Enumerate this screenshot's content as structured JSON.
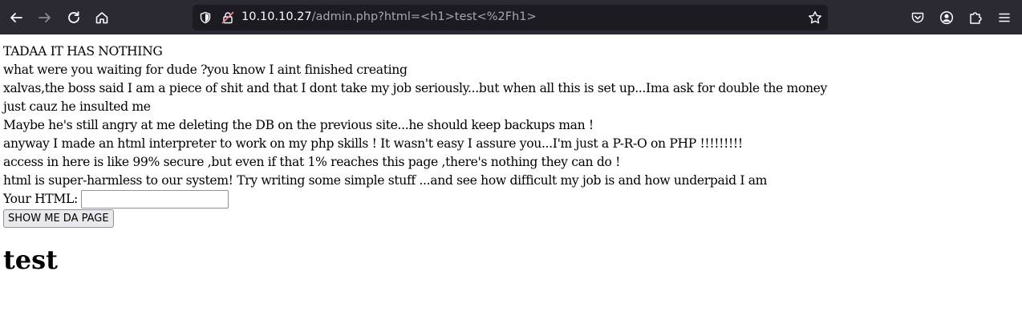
{
  "browser": {
    "url_host": "10.10.10.27",
    "url_path": "/admin.php?html=<h1>test<%2Fh1>"
  },
  "page": {
    "lines": [
      "TADAA IT HAS NOTHING",
      "what were you waiting for dude ?you know I aint finished creating",
      "xalvas,the boss said I am a piece of shit and that I dont take my job seriously...but when all this is set up...Ima ask for double the money",
      "just cauz he insulted me",
      "Maybe he's still angry at me deleting the DB on the previous site...he should keep backups man !",
      "anyway I made an html interpreter to work on my php skills ! It wasn't easy I assure you...I'm just a P-R-O on PHP !!!!!!!!!",
      "access in here is like 99% secure ,but even if that 1% reaches this page ,there's nothing they can do !",
      "html is super-harmless to our system! Try writing some simple stuff ...and see how difficult my job is and how underpaid I am"
    ],
    "form": {
      "label": "Your HTML:",
      "input_value": "",
      "button_label": "SHOW ME DA PAGE"
    },
    "rendered_heading": "test"
  },
  "colors": {
    "toolbar_bg": "#2b2a33",
    "urlbar_bg": "#1c1b22",
    "icon": "#fbfbfe"
  }
}
